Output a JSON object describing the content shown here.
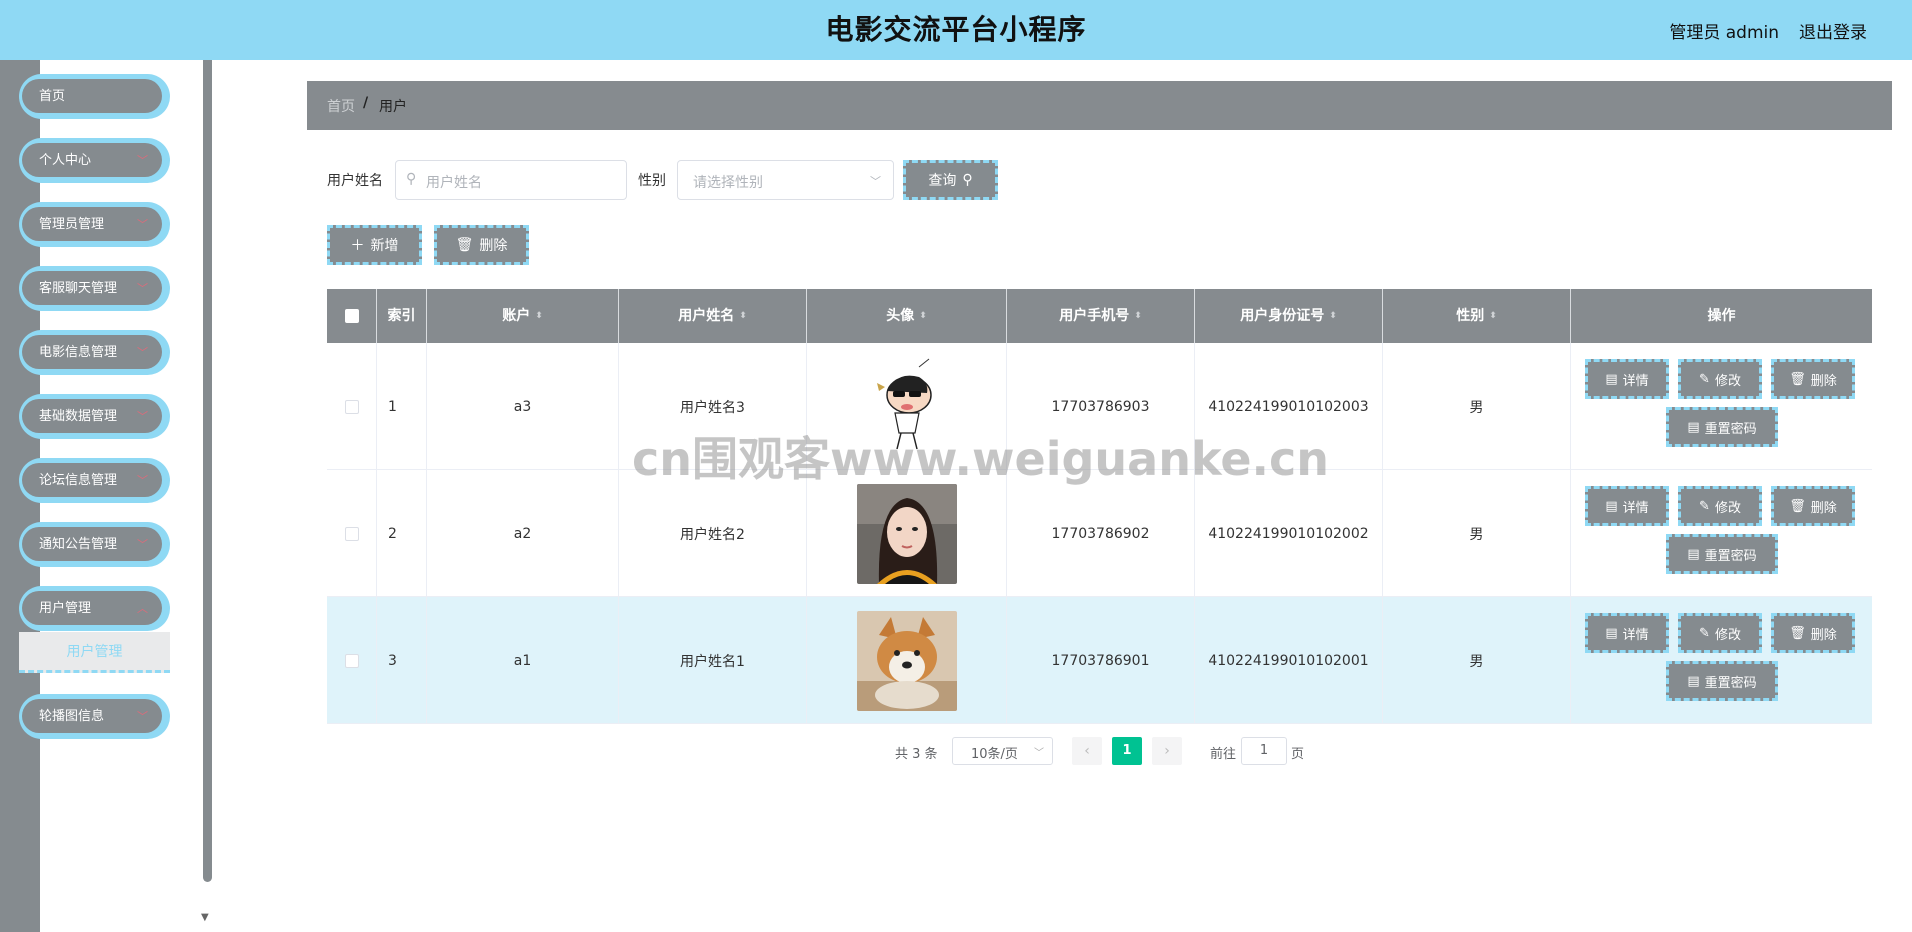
{
  "header": {
    "title": "电影交流平台小程序",
    "admin_label": "管理员 admin",
    "logout_label": "退出登录",
    "bg_color": "#8fd9f4"
  },
  "sidebar": {
    "items": [
      {
        "label": "首页"
      },
      {
        "label": "个人中心"
      },
      {
        "label": "管理员管理"
      },
      {
        "label": "客服聊天管理"
      },
      {
        "label": "电影信息管理"
      },
      {
        "label": "基础数据管理"
      },
      {
        "label": "论坛信息管理"
      },
      {
        "label": "通知公告管理"
      },
      {
        "label": "用户管理"
      },
      {
        "label": "轮播图信息"
      }
    ],
    "active_sub": "用户管理"
  },
  "breadcrumb": {
    "home": "首页",
    "separator": "/",
    "current": "用户"
  },
  "search": {
    "name_label": "用户姓名",
    "name_placeholder": "用户姓名",
    "gender_label": "性别",
    "gender_placeholder": "请选择性别",
    "query_label": "查询"
  },
  "actions": {
    "add_label": "新增",
    "delete_label": "删除"
  },
  "table": {
    "columns": [
      "索引",
      "账户",
      "用户姓名",
      "头像",
      "用户手机号",
      "用户身份证号",
      "性别",
      "操作"
    ],
    "rows": [
      {
        "index": "1",
        "account": "a3",
        "name": "用户姓名3",
        "phone": "17703786903",
        "id_card": "410224199010102003",
        "gender": "男"
      },
      {
        "index": "2",
        "account": "a2",
        "name": "用户姓名2",
        "phone": "17703786902",
        "id_card": "410224199010102002",
        "gender": "男"
      },
      {
        "index": "3",
        "account": "a1",
        "name": "用户姓名1",
        "phone": "17703786901",
        "id_card": "410224199010102001",
        "gender": "男"
      }
    ],
    "row_actions": {
      "detail": "详情",
      "edit": "修改",
      "delete": "删除",
      "reset_password": "重置密码"
    }
  },
  "pagination": {
    "total_text": "共 3 条",
    "page_size": "10条/页",
    "current_page": "1",
    "goto_prefix": "前往",
    "goto_value": "1",
    "goto_suffix": "页",
    "active_color": "#00c292"
  },
  "watermark": "cn围观客www.weiguanke.cn"
}
